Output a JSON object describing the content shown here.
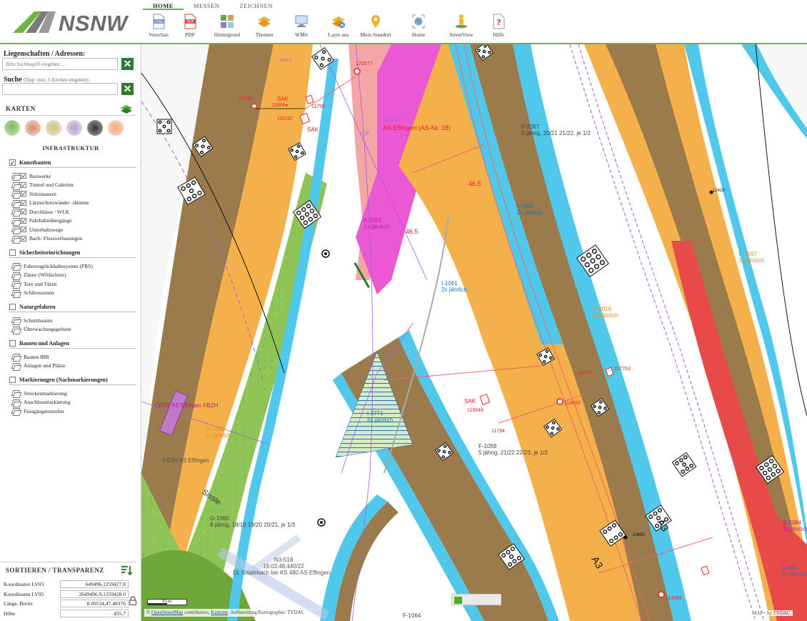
{
  "app": {
    "logo_text": "NSNW"
  },
  "tabs": [
    "HOME",
    "MESSEN",
    "ZEICHNEN"
  ],
  "toolbar": [
    {
      "label": "Vorschau",
      "icon": "html-preview-icon"
    },
    {
      "label": "PDF",
      "icon": "pdf-icon"
    },
    {
      "label": "Hintergrund",
      "icon": "background-icon"
    },
    {
      "label": "Themen",
      "icon": "layers-icon"
    },
    {
      "label": "WMS",
      "icon": "wms-icon"
    },
    {
      "label": "Layer aus",
      "icon": "layers-off-icon"
    },
    {
      "label": "Mein Standort",
      "icon": "location-pin-icon"
    },
    {
      "label": "Home",
      "icon": "home-globe-icon"
    },
    {
      "label": "StreetView",
      "icon": "streetview-icon"
    },
    {
      "label": "Hilfe",
      "icon": "help-icon"
    }
  ],
  "sidebar": {
    "search_address_label": "Liegenschaften / Adressen:",
    "search_address_placeholder": "Bitte Suchbegriff eingeben ...",
    "search_label": "Suche",
    "search_hint": "(Tipp: min. 3 Zeichen eingeben):",
    "search_placeholder": "",
    "clear_symbol": "✕",
    "karten_title": "KARTEN",
    "infra_title": "INFRASTRUKTUR",
    "groups": [
      {
        "title": "Kunstbauten",
        "checked": true,
        "items": [
          {
            "label": "Bauwerke",
            "checked": true
          },
          {
            "label": "Tunnel und Galerien",
            "checked": true
          },
          {
            "label": "Stützmauern",
            "checked": true
          },
          {
            "label": "Lärmschutzwände/ -dämme",
            "checked": true
          },
          {
            "label": "Durchlässe / WLK",
            "checked": true
          },
          {
            "label": "Fahrbahnübergänge",
            "checked": true
          },
          {
            "label": "Unterhaltswege",
            "checked": true
          },
          {
            "label": "Bach- Flussverbauungen",
            "checked": true
          }
        ]
      },
      {
        "title": "Sicherheitseinrichtungen",
        "checked": false,
        "items": [
          {
            "label": "Fahrzeugrückhaltesystem (FRS)",
            "checked": false
          },
          {
            "label": "Zäune (Wildschutz)",
            "checked": false
          },
          {
            "label": "Tore und Türen",
            "checked": false
          },
          {
            "label": "Schliesszonen",
            "checked": false
          }
        ]
      },
      {
        "title": "Naturgefahren",
        "checked": false,
        "items": [
          {
            "label": "Schutzbauten",
            "checked": false
          },
          {
            "label": "Überwachungsgebiete",
            "checked": false
          }
        ]
      },
      {
        "title": "Bauten und Anlagen",
        "checked": false,
        "items": [
          {
            "label": "Bauten IBB",
            "checked": false
          },
          {
            "label": "Anlagen und Plätze",
            "checked": false
          }
        ]
      },
      {
        "title": "Markierungen (Nachmarkierungen)",
        "checked": false,
        "items": [
          {
            "label": "Streckenmarkierung",
            "checked": false
          },
          {
            "label": "Anschlussmarkierung",
            "checked": false
          },
          {
            "label": "Fussgängerstreifen",
            "checked": false
          }
        ]
      }
    ],
    "sort_title": "SORTIEREN / TRANSPARENZ",
    "coords": [
      {
        "label": "Koordinaten LV03",
        "value": "649496,1259427.8"
      },
      {
        "label": "Koordinaten LV95",
        "value": "2649496.9,1259428.0"
      },
      {
        "label": "Länge, Breite",
        "value": "8.09534,47.48376"
      },
      {
        "label": "Höhe",
        "value": "435.7"
      }
    ]
  },
  "map": {
    "scale": "10 m",
    "attribution_prefix": "©",
    "attribution_osm": "OpenStreetMap",
    "attribution_mid": "contributors,",
    "attribution_kantone": "Kantone",
    "attribution_suffix": ". Aufbereitung/Kartographie: TYDAC",
    "mapby": "MAP+ by TYDAC",
    "labels": {
      "sak1": "SAK",
      "id11884": "11884●",
      "sak2": "SAK",
      "id116187": "116187",
      "id11795": "11795",
      "id19443": "19443",
      "n3_517": "N3-517",
      "as_effingen": "AS Effingen (AS-Nr. 18)",
      "ucf": "LCF",
      "f2087": "F-2087",
      "f2087_sub": "5 jährig, 20/21 21/22, je 1/2",
      "i2085": "I-2085",
      "i2085_sub": "2x jährlich",
      "id12418": "12418",
      "d7097": "D-7097",
      "d7097_sub": "1x jährlich",
      "a1051": "A-1051",
      "a1051_sub": "1x jährlich",
      "i1061": "I-1061",
      "i1061_sub": "2x jährlich",
      "d2016": "D-2016",
      "d2016_sub": "1x jährlich",
      "id46_5a": "46.5",
      "id46_5b": "46.5",
      "sak3": "SAK",
      "id118848": "118848",
      "id114059": "114059",
      "id117763": "117763",
      "id11776": "11776",
      "id11794": "11794",
      "f1059": "F-1059",
      "f1059_sub": "5 jährig, 21/22 22/23, je 1/2",
      "i3771": "I-3771",
      "i3771_sub": "4x jährlich",
      "orzb": "ÖRZB AS Effingen FBZH",
      "d1058": "D-1058",
      "d1058_sub": "1x jährlich",
      "fbzh": "FBZH AS Effingen",
      "sissle": "Sissle",
      "g1060": "G-1060",
      "g1060_sub": "8 jährig, 18/19 19/20 20/21, je 1/3",
      "n3_518": "N3-518",
      "n3_518_sub": "19.03.48.440/22",
      "dl_sissle": "DL Sisslebach bei KS 480 AS Effingen",
      "a3a": "A3",
      "a3b": "A3",
      "b2084": "B-2084",
      "b2084_sub": "1x jährlich",
      "i2080": "I-2080",
      "i2080_sub": "2x jährlich",
      "id114059b": "114059",
      "id13650": "13650",
      "f1064": "F-1064",
      "id120577": "120577",
      "id12413": "12413"
    }
  }
}
